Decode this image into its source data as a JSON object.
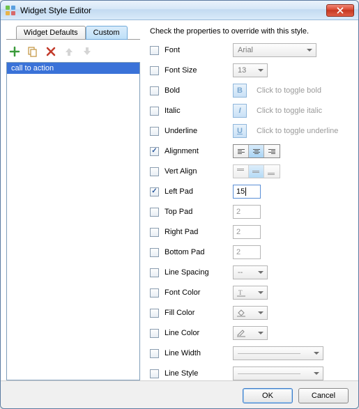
{
  "window": {
    "title": "Widget Style Editor"
  },
  "tabs": {
    "defaults": "Widget Defaults",
    "custom": "Custom",
    "active": "custom"
  },
  "styles": {
    "items": [
      "call to action"
    ],
    "selected_index": 0
  },
  "hint": "Check the properties to override with this style.",
  "props": {
    "font": {
      "label": "Font",
      "checked": false,
      "value": "Arial"
    },
    "font_size": {
      "label": "Font Size",
      "checked": false,
      "value": "13"
    },
    "bold": {
      "label": "Bold",
      "checked": false,
      "hint": "Click to toggle bold",
      "glyph": "B"
    },
    "italic": {
      "label": "Italic",
      "checked": false,
      "hint": "Click to toggle italic",
      "glyph": "I"
    },
    "underline": {
      "label": "Underline",
      "checked": false,
      "hint": "Click to toggle underline",
      "glyph": "U"
    },
    "alignment": {
      "label": "Alignment",
      "checked": true,
      "value": "center"
    },
    "vert_align": {
      "label": "Vert Align",
      "checked": false,
      "value": "middle"
    },
    "left_pad": {
      "label": "Left Pad",
      "checked": true,
      "value": "15"
    },
    "top_pad": {
      "label": "Top Pad",
      "checked": false,
      "value": "2"
    },
    "right_pad": {
      "label": "Right Pad",
      "checked": false,
      "value": "2"
    },
    "bottom_pad": {
      "label": "Bottom Pad",
      "checked": false,
      "value": "2"
    },
    "line_spacing": {
      "label": "Line Spacing",
      "checked": false,
      "value": "--"
    },
    "font_color": {
      "label": "Font Color",
      "checked": false
    },
    "fill_color": {
      "label": "Fill Color",
      "checked": false
    },
    "line_color": {
      "label": "Line Color",
      "checked": false
    },
    "line_width": {
      "label": "Line Width",
      "checked": false
    },
    "line_style": {
      "label": "Line Style",
      "checked": false
    }
  },
  "buttons": {
    "ok": "OK",
    "cancel": "Cancel"
  }
}
